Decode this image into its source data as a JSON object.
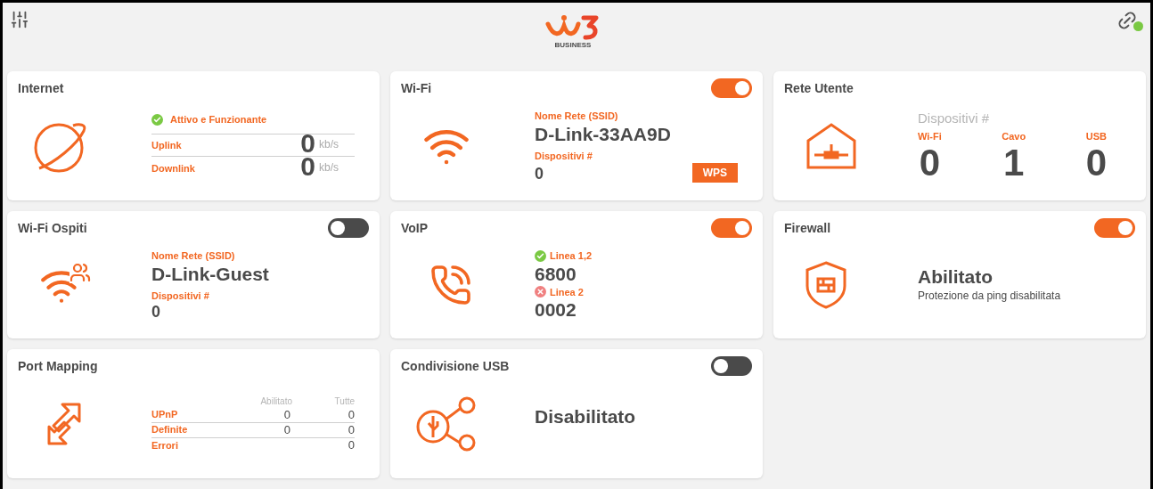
{
  "header": {
    "logo_caption": "BUSINESS",
    "connected": true
  },
  "cards": [
    {
      "kind": "internet",
      "title": "Internet",
      "status": {
        "text": "Attivo e Funzionante",
        "ok": true
      },
      "rows": [
        {
          "label": "Uplink",
          "value": "0",
          "unit": "kb/s"
        },
        {
          "label": "Downlink",
          "value": "0",
          "unit": "kb/s"
        }
      ]
    },
    {
      "kind": "wifi",
      "title": "Wi-Fi",
      "on": true,
      "ssid_label": "Nome Rete (SSID)",
      "ssid": "D-Link-33AA9D",
      "devices_label": "Dispositivi #",
      "devices": "0",
      "button": "WPS"
    },
    {
      "kind": "lan",
      "title": "Rete Utente",
      "devices_label": "Dispositivi #",
      "columns": [
        {
          "label": "Wi-Fi",
          "value": "0"
        },
        {
          "label": "Cavo",
          "value": "1"
        },
        {
          "label": "USB",
          "value": "0"
        }
      ]
    },
    {
      "kind": "guest",
      "title": "Wi-Fi Ospiti",
      "on": false,
      "ssid_label": "Nome Rete (SSID)",
      "ssid": "D-Link-Guest",
      "devices_label": "Dispositivi #",
      "devices": "0"
    },
    {
      "kind": "voip",
      "title": "VoIP",
      "on": true,
      "lines": [
        {
          "label": "Linea 1,2",
          "ok": true,
          "value": "6800"
        },
        {
          "label": "Linea 2",
          "ok": false,
          "value": "0002"
        }
      ]
    },
    {
      "kind": "firewall",
      "title": "Firewall",
      "on": true,
      "status": "Abilitato",
      "note": "Protezione da ping disabilitata"
    },
    {
      "kind": "ports",
      "title": "Port Mapping",
      "columns": [
        "Abilitato",
        "Tutte"
      ],
      "rows": [
        {
          "label": "UPnP",
          "enabled": "0",
          "all": "0"
        },
        {
          "label": "Definite",
          "enabled": "0",
          "all": "0"
        },
        {
          "label": "Errori",
          "all": "0"
        }
      ]
    },
    {
      "kind": "usb",
      "title": "Condivisione USB",
      "on": false,
      "status": "Disabilitato"
    }
  ]
}
